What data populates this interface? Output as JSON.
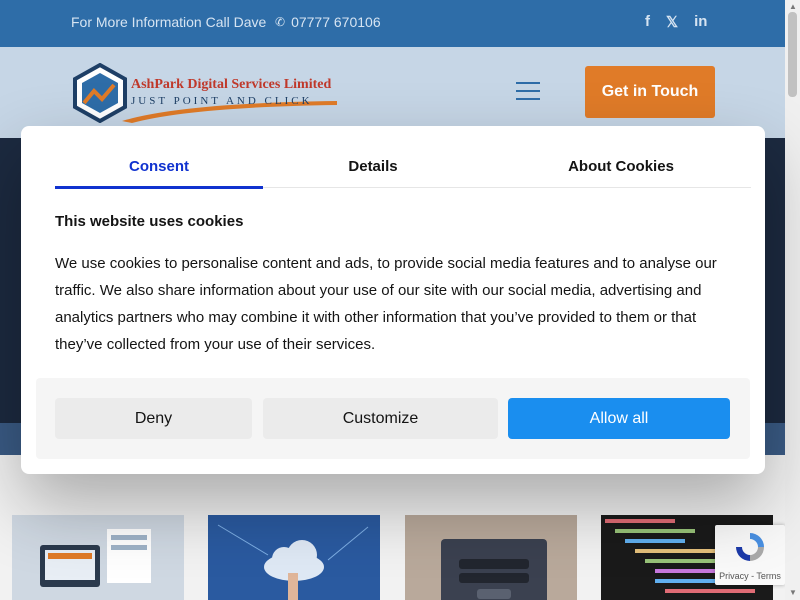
{
  "topbar": {
    "info": "For More Information Call Dave",
    "phone": "07777 670106",
    "social": [
      "f",
      "𝕏",
      "in"
    ]
  },
  "header": {
    "logo_title": "AshPark Digital Services Limited",
    "logo_tagline": "JUST POINT AND CLICK",
    "cta_label": "Get in Touch"
  },
  "cookie": {
    "tabs": [
      "Consent",
      "Details",
      "About Cookies"
    ],
    "title": "This website uses cookies",
    "body": "We use cookies to personalise content and ads, to provide social media features and to analyse our traffic. We also share information about your use of our site with our social media, advertising and analytics partners who may combine it with other information that you’ve provided to them or that they’ve collected from your use of their services.",
    "deny_label": "Deny",
    "customize_label": "Customize",
    "allow_label": "Allow all"
  },
  "recaptcha": {
    "text": "Privacy - Terms"
  },
  "colors": {
    "topbar": "#2e6da8",
    "accent_orange": "#e07b28",
    "consent_blue": "#1032cf",
    "allow_blue": "#1a8eef"
  }
}
